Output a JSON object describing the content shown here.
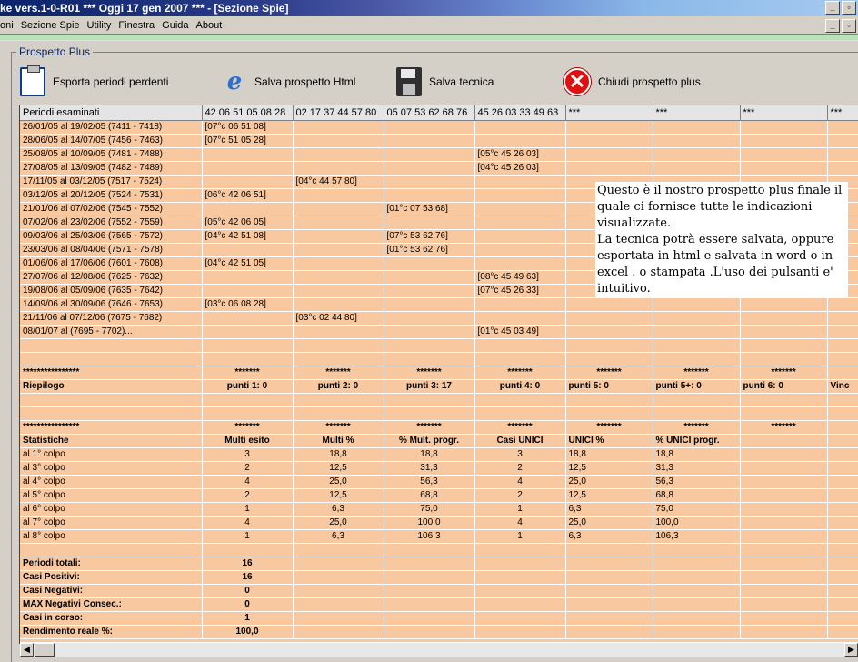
{
  "window": {
    "title": "ke vers.1-0-R01  ***  Oggi 17 gen 2007  ***  - [Sezione Spie]"
  },
  "menu": [
    "oni",
    "Sezione Spie",
    "Utility",
    "Finestra",
    "Guida",
    "About"
  ],
  "panel_title": "Prospetto Plus",
  "toolbar": {
    "export": "Esporta periodi perdenti",
    "save_html": "Salva prospetto Html",
    "save_tech": "Salva tecnica",
    "close": "Chiudi prospetto plus"
  },
  "columns": [
    "Periodi esaminati",
    "42 06 51 05 08 28",
    "02 17 37 44 57 80",
    "05 07 53 62 68 76",
    "45 26 03 33 49 63",
    "***",
    "***",
    "***",
    "***"
  ],
  "periods": [
    [
      "26/01/05 al 19/02/05  (7411 - 7418)",
      "[07°c 06 51 08]",
      "",
      "",
      ""
    ],
    [
      "28/06/05 al 14/07/05  (7456 - 7463)",
      "[07°c 51 05 28]",
      "",
      "",
      ""
    ],
    [
      "25/08/05 al 10/09/05  (7481 - 7488)",
      "",
      "",
      "",
      "[05°c 45 26 03]"
    ],
    [
      "27/08/05 al 13/09/05  (7482 - 7489)",
      "",
      "",
      "",
      "[04°c 45 26 03]"
    ],
    [
      "17/11/05 al 03/12/05  (7517 - 7524)",
      "",
      "[04°c 44 57 80]",
      "",
      ""
    ],
    [
      "03/12/05 al 20/12/05  (7524 - 7531)",
      "[06°c 42 06 51]",
      "",
      "",
      ""
    ],
    [
      "21/01/06 al 07/02/06  (7545 - 7552)",
      "",
      "",
      "[01°c 07 53 68]",
      ""
    ],
    [
      "07/02/06 al 23/02/06  (7552 - 7559)",
      "[05°c 42 06 05]",
      "",
      "",
      ""
    ],
    [
      "09/03/06 al 25/03/06  (7565 - 7572)",
      "[04°c 42 51 08]",
      "",
      "[07°c 53 62 76]",
      ""
    ],
    [
      "23/03/06 al 08/04/06  (7571 - 7578)",
      "",
      "",
      "[01°c 53 62 76]",
      ""
    ],
    [
      "01/06/06 al 17/06/06  (7601 - 7608)",
      "[04°c 42 51 05]",
      "",
      "",
      ""
    ],
    [
      "27/07/06 al 12/08/06  (7625 - 7632)",
      "",
      "",
      "",
      "[08°c 45 49 63]"
    ],
    [
      "19/08/06 al 05/09/06  (7635 - 7642)",
      "",
      "",
      "",
      "[07°c 45 26 33]"
    ],
    [
      "14/09/06 al 30/09/06  (7646 - 7653)",
      "[03°c 06 08 28]",
      "",
      "",
      ""
    ],
    [
      "21/11/06 al 07/12/06  (7675 - 7682)",
      "",
      "[03°c 02 44 80]",
      "",
      ""
    ],
    [
      "08/01/07 al   (7695 - 7702)...",
      "",
      "",
      "",
      "[01°c 45 03 49]"
    ]
  ],
  "stars_long": "****************",
  "stars_short": "*******",
  "riepilogo": {
    "label": "Riepilogo",
    "cells": [
      "punti 1: 0",
      "punti 2: 0",
      "punti 3: 17",
      "punti 4: 0",
      "punti 5: 0",
      "punti 5+: 0",
      "punti 6: 0",
      "Vinc"
    ]
  },
  "statistiche": {
    "headers": [
      "Statistiche",
      "Multi esito",
      "Multi %",
      "% Mult. progr.",
      "Casi UNICI",
      "UNICI %",
      "% UNICI progr."
    ],
    "rows": [
      [
        "al 1° colpo",
        "3",
        "18,8",
        "18,8",
        "3",
        "18,8",
        "18,8"
      ],
      [
        "al 3° colpo",
        "2",
        "12,5",
        "31,3",
        "2",
        "12,5",
        "31,3"
      ],
      [
        "al 4° colpo",
        "4",
        "25,0",
        "56,3",
        "4",
        "25,0",
        "56,3"
      ],
      [
        "al 5° colpo",
        "2",
        "12,5",
        "68,8",
        "2",
        "12,5",
        "68,8"
      ],
      [
        "al 6° colpo",
        "1",
        "6,3",
        "75,0",
        "1",
        "6,3",
        "75,0"
      ],
      [
        "al 7° colpo",
        "4",
        "25,0",
        "100,0",
        "4",
        "25,0",
        "100,0"
      ],
      [
        "al 8° colpo",
        "1",
        "6,3",
        "106,3",
        "1",
        "6,3",
        "106,3"
      ]
    ]
  },
  "totals": [
    [
      "Periodi totali:",
      "16"
    ],
    [
      "Casi Positivi:",
      "16"
    ],
    [
      "Casi Negativi:",
      "0"
    ],
    [
      "MAX Negativi Consec.:",
      "0"
    ],
    [
      "Casi in corso:",
      "1"
    ]
  ],
  "rendimento": {
    "label": "Rendimento reale %:",
    "value": "100,0"
  },
  "note": "Questo è il nostro prospetto plus finale il quale ci fornisce tutte le indicazioni visualizzate.\nLa tecnica potrà essere salvata, oppure esportata in html e salvata in word o in excel . o stampata .L'uso dei pulsanti e' intuitivo."
}
